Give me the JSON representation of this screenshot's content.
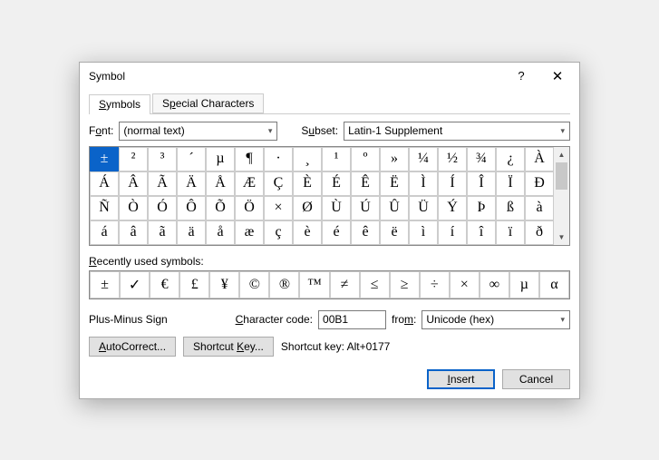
{
  "window": {
    "title": "Symbol",
    "help": "?",
    "close": "✕"
  },
  "tabs": {
    "symbols": "Symbols",
    "special": "Special Characters",
    "s_u": "S",
    "p_u": "p"
  },
  "font": {
    "label_pre": "F",
    "label_u": "o",
    "label_post": "nt:",
    "value": "(normal text)"
  },
  "subset": {
    "label_pre": "S",
    "label_u": "u",
    "label_post": "bset:",
    "value": "Latin-1 Supplement"
  },
  "grid": [
    [
      "±",
      "²",
      "³",
      "´",
      "µ",
      "¶",
      "·",
      "¸",
      "¹",
      "º",
      "»",
      "¼",
      "½",
      "¾",
      "¿",
      "À"
    ],
    [
      "Á",
      "Â",
      "Ã",
      "Ä",
      "Å",
      "Æ",
      "Ç",
      "È",
      "É",
      "Ê",
      "Ë",
      "Ì",
      "Í",
      "Î",
      "Ï",
      "Ð"
    ],
    [
      "Ñ",
      "Ò",
      "Ó",
      "Ô",
      "Õ",
      "Ö",
      "×",
      "Ø",
      "Ù",
      "Ú",
      "Û",
      "Ü",
      "Ý",
      "Þ",
      "ß",
      "à"
    ],
    [
      "á",
      "â",
      "ã",
      "ä",
      "å",
      "æ",
      "ç",
      "è",
      "é",
      "ê",
      "ë",
      "ì",
      "í",
      "î",
      "ï",
      "ð"
    ]
  ],
  "recent": {
    "label_pre": "",
    "label_u": "R",
    "label_post": "ecently used symbols:",
    "items": [
      "±",
      "✓",
      "€",
      "£",
      "¥",
      "©",
      "®",
      "™",
      "≠",
      "≤",
      "≥",
      "÷",
      "×",
      "∞",
      "µ",
      "α"
    ]
  },
  "info": {
    "name": "Plus-Minus Sign",
    "code_label_pre": "",
    "code_label_u": "C",
    "code_label_post": "haracter code:",
    "code": "00B1",
    "from_label_pre": "fro",
    "from_label_u": "m",
    "from_label_post": ":",
    "from": "Unicode (hex)"
  },
  "buttons": {
    "autocorrect_pre": "",
    "autocorrect_u": "A",
    "autocorrect_post": "utoCorrect...",
    "shortcut_pre": "Shortcut ",
    "shortcut_u": "K",
    "shortcut_post": "ey...",
    "shortcut_text": "Shortcut key: Alt+0177",
    "insert_pre": "",
    "insert_u": "I",
    "insert_post": "nsert",
    "cancel": "Cancel"
  }
}
